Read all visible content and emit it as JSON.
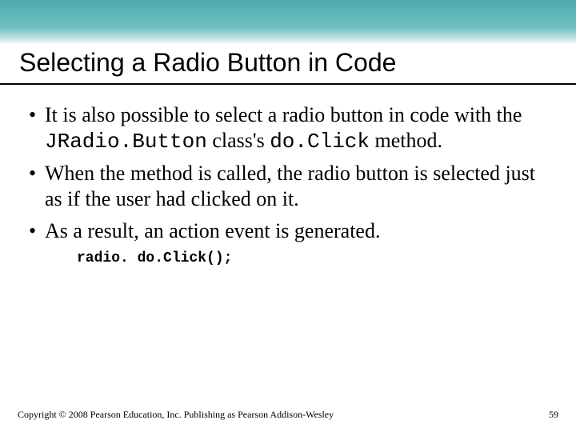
{
  "title": "Selecting a Radio Button in Code",
  "bullets": {
    "b1_pre": "It is also possible to select a radio button in code with the ",
    "b1_code1": "JRadio.Button",
    "b1_mid": " class's ",
    "b1_code2": "do.Click",
    "b1_post": " method.",
    "b2": "When the method is called, the radio button is selected just as if the user had clicked on it.",
    "b3": "As a result, an action event is generated."
  },
  "code_example": "radio. do.Click();",
  "footer": {
    "copyright": "Copyright © 2008 Pearson Education, Inc. Publishing as Pearson Addison-Wesley",
    "page": "59"
  },
  "glyphs": {
    "bullet": "•"
  }
}
